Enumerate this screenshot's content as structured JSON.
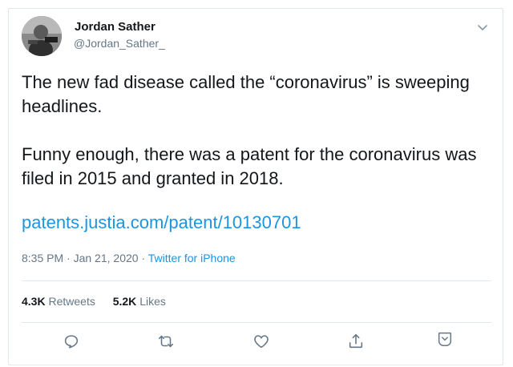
{
  "tweet": {
    "author": {
      "name": "Jordan Sather",
      "handle": "@Jordan_Sather_"
    },
    "text_paragraphs": [
      "The new fad disease called the “coronavirus” is sweeping headlines.",
      "Funny enough, there was a patent for the coronavirus was filed in 2015 and granted in 2018."
    ],
    "link": "patents.justia.com/patent/10130701",
    "meta": {
      "time": "8:35 PM",
      "separator": " · ",
      "date": "Jan 21, 2020",
      "source": "Twitter for iPhone"
    },
    "stats": {
      "retweets_count": "4.3K",
      "retweets_label": "Retweets",
      "likes_count": "5.2K",
      "likes_label": "Likes"
    },
    "actions": {
      "reply_icon": "reply-icon",
      "retweet_icon": "retweet-icon",
      "like_icon": "heart-icon",
      "share_icon": "share-icon",
      "more_icon": "caret-icon"
    },
    "colors": {
      "link": "#1b95e0",
      "secondary_text": "#657786",
      "border": "#e1e8ed"
    }
  }
}
